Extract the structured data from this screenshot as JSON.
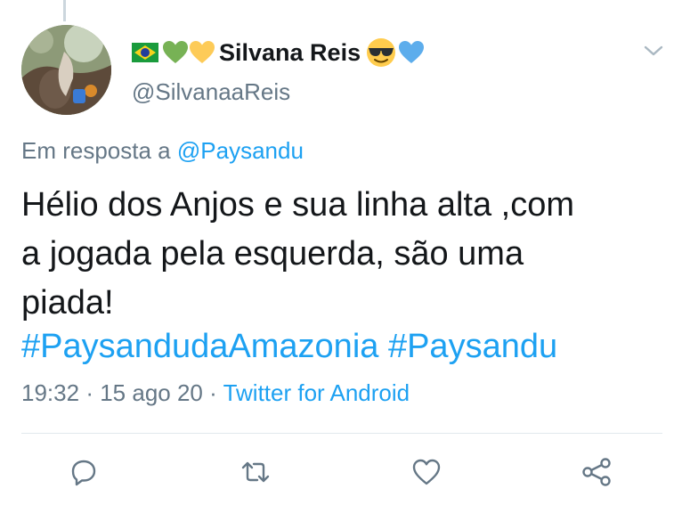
{
  "author": {
    "display_name": "Silvana Reis",
    "handle": "@SilvanaaReis",
    "name_emojis_before": [
      "flag-brazil",
      "green-heart",
      "yellow-heart"
    ],
    "name_emojis_after": [
      "smiling-face-with-sunglasses",
      "blue-heart"
    ]
  },
  "reply": {
    "prefix": "Em resposta a",
    "mention": "@Paysandu"
  },
  "tweet": {
    "lines": [
      "Hélio dos Anjos e sua linha alta ,com",
      "a jogada pela esquerda, são uma",
      "piada!"
    ],
    "hashtags": "#PaysandudaAmazonia #Paysandu"
  },
  "meta": {
    "time": "19:32",
    "separator": "·",
    "date": "15 ago 20",
    "source": "Twitter for Android"
  },
  "actions": [
    "reply-icon",
    "retweet-icon",
    "like-icon",
    "share-icon"
  ],
  "colors": {
    "link": "#1da1f2",
    "secondary_text": "#657786",
    "icon": "#657786",
    "divider": "#e1e8ed"
  }
}
